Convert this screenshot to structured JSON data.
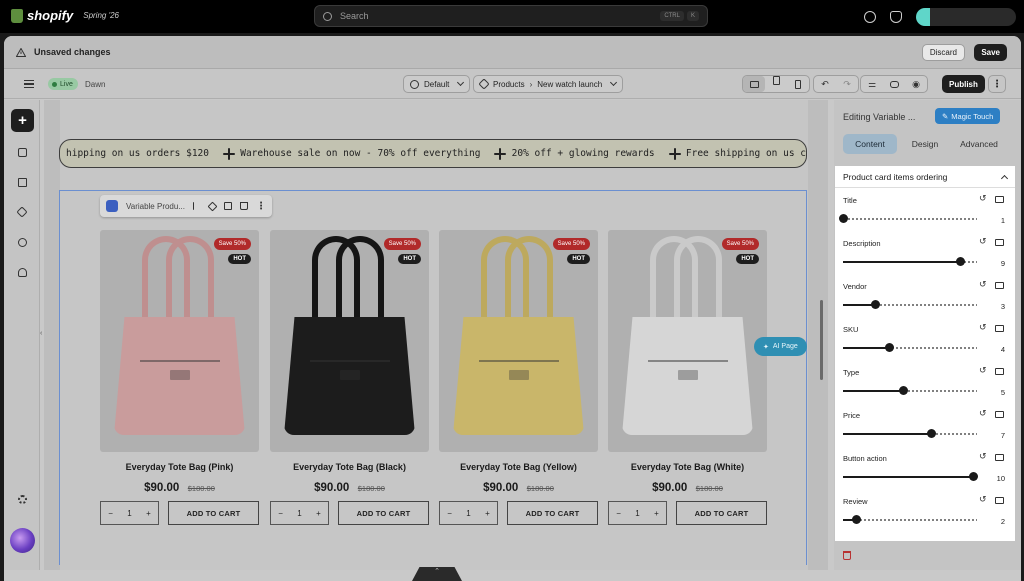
{
  "topbar": {
    "logo_text": "shopify",
    "edition": "Spring '26",
    "search_placeholder": "Search",
    "kbd_ctrl": "CTRL",
    "kbd_k": "K"
  },
  "unsaved": {
    "message": "Unsaved changes",
    "discard_label": "Discard",
    "save_label": "Save"
  },
  "toolbar": {
    "live_label": "Live",
    "theme_name": "Dawn",
    "template_label": "Default",
    "products_label": "Products",
    "product_name": "New watch launch",
    "publish_label": "Publish"
  },
  "marquee": {
    "items": [
      "hipping on us orders $120",
      "Warehouse sale on now - 70% off everything",
      "20% off + glowing rewards",
      "Free shipping on us c"
    ]
  },
  "section_toolbar": {
    "name": "Variable Produ..."
  },
  "products": [
    {
      "title": "Everyday Tote Bag (Pink)",
      "price": "$90.00",
      "compare": "$180.00",
      "save_badge": "Save 50%",
      "hot_badge": "HOT",
      "qty": "1",
      "cart_label": "ADD TO CART",
      "color": "#c99c9c",
      "handle": "#bf8f8f"
    },
    {
      "title": "Everyday Tote Bag (Black)",
      "price": "$90.00",
      "compare": "$180.00",
      "save_badge": "Save 50%",
      "hot_badge": "HOT",
      "qty": "1",
      "cart_label": "ADD TO CART",
      "color": "#1c1c1c",
      "handle": "#151515"
    },
    {
      "title": "Everyday Tote Bag (Yellow)",
      "price": "$90.00",
      "compare": "$180.00",
      "save_badge": "Save 50%",
      "hot_badge": "HOT",
      "qty": "1",
      "cart_label": "ADD TO CART",
      "color": "#c9b66a",
      "handle": "#bda95e"
    },
    {
      "title": "Everyday Tote Bag (White)",
      "price": "$90.00",
      "compare": "$180.00",
      "save_badge": "Save 50%",
      "hot_badge": "HOT",
      "qty": "1",
      "cart_label": "ADD TO CART",
      "color": "#d6d6d6",
      "handle": "#cacaca"
    }
  ],
  "ai_page_label": "AI Page",
  "panel": {
    "title": "Editing Variable ...",
    "magic_label": "Magic Touch",
    "tabs": [
      "Content",
      "Design",
      "Advanced"
    ],
    "section_title": "Product card items ordering",
    "fields": [
      {
        "label": "Title",
        "value": "1",
        "level": 0.0
      },
      {
        "label": "Description",
        "value": "9",
        "level": 0.87
      },
      {
        "label": "Vendor",
        "value": "3",
        "level": 0.24
      },
      {
        "label": "SKU",
        "value": "4",
        "level": 0.34
      },
      {
        "label": "Type",
        "value": "5",
        "level": 0.45
      },
      {
        "label": "Price",
        "value": "7",
        "level": 0.66
      },
      {
        "label": "Button action",
        "value": "10",
        "level": 0.97
      },
      {
        "label": "Review",
        "value": "2",
        "level": 0.1
      }
    ]
  }
}
